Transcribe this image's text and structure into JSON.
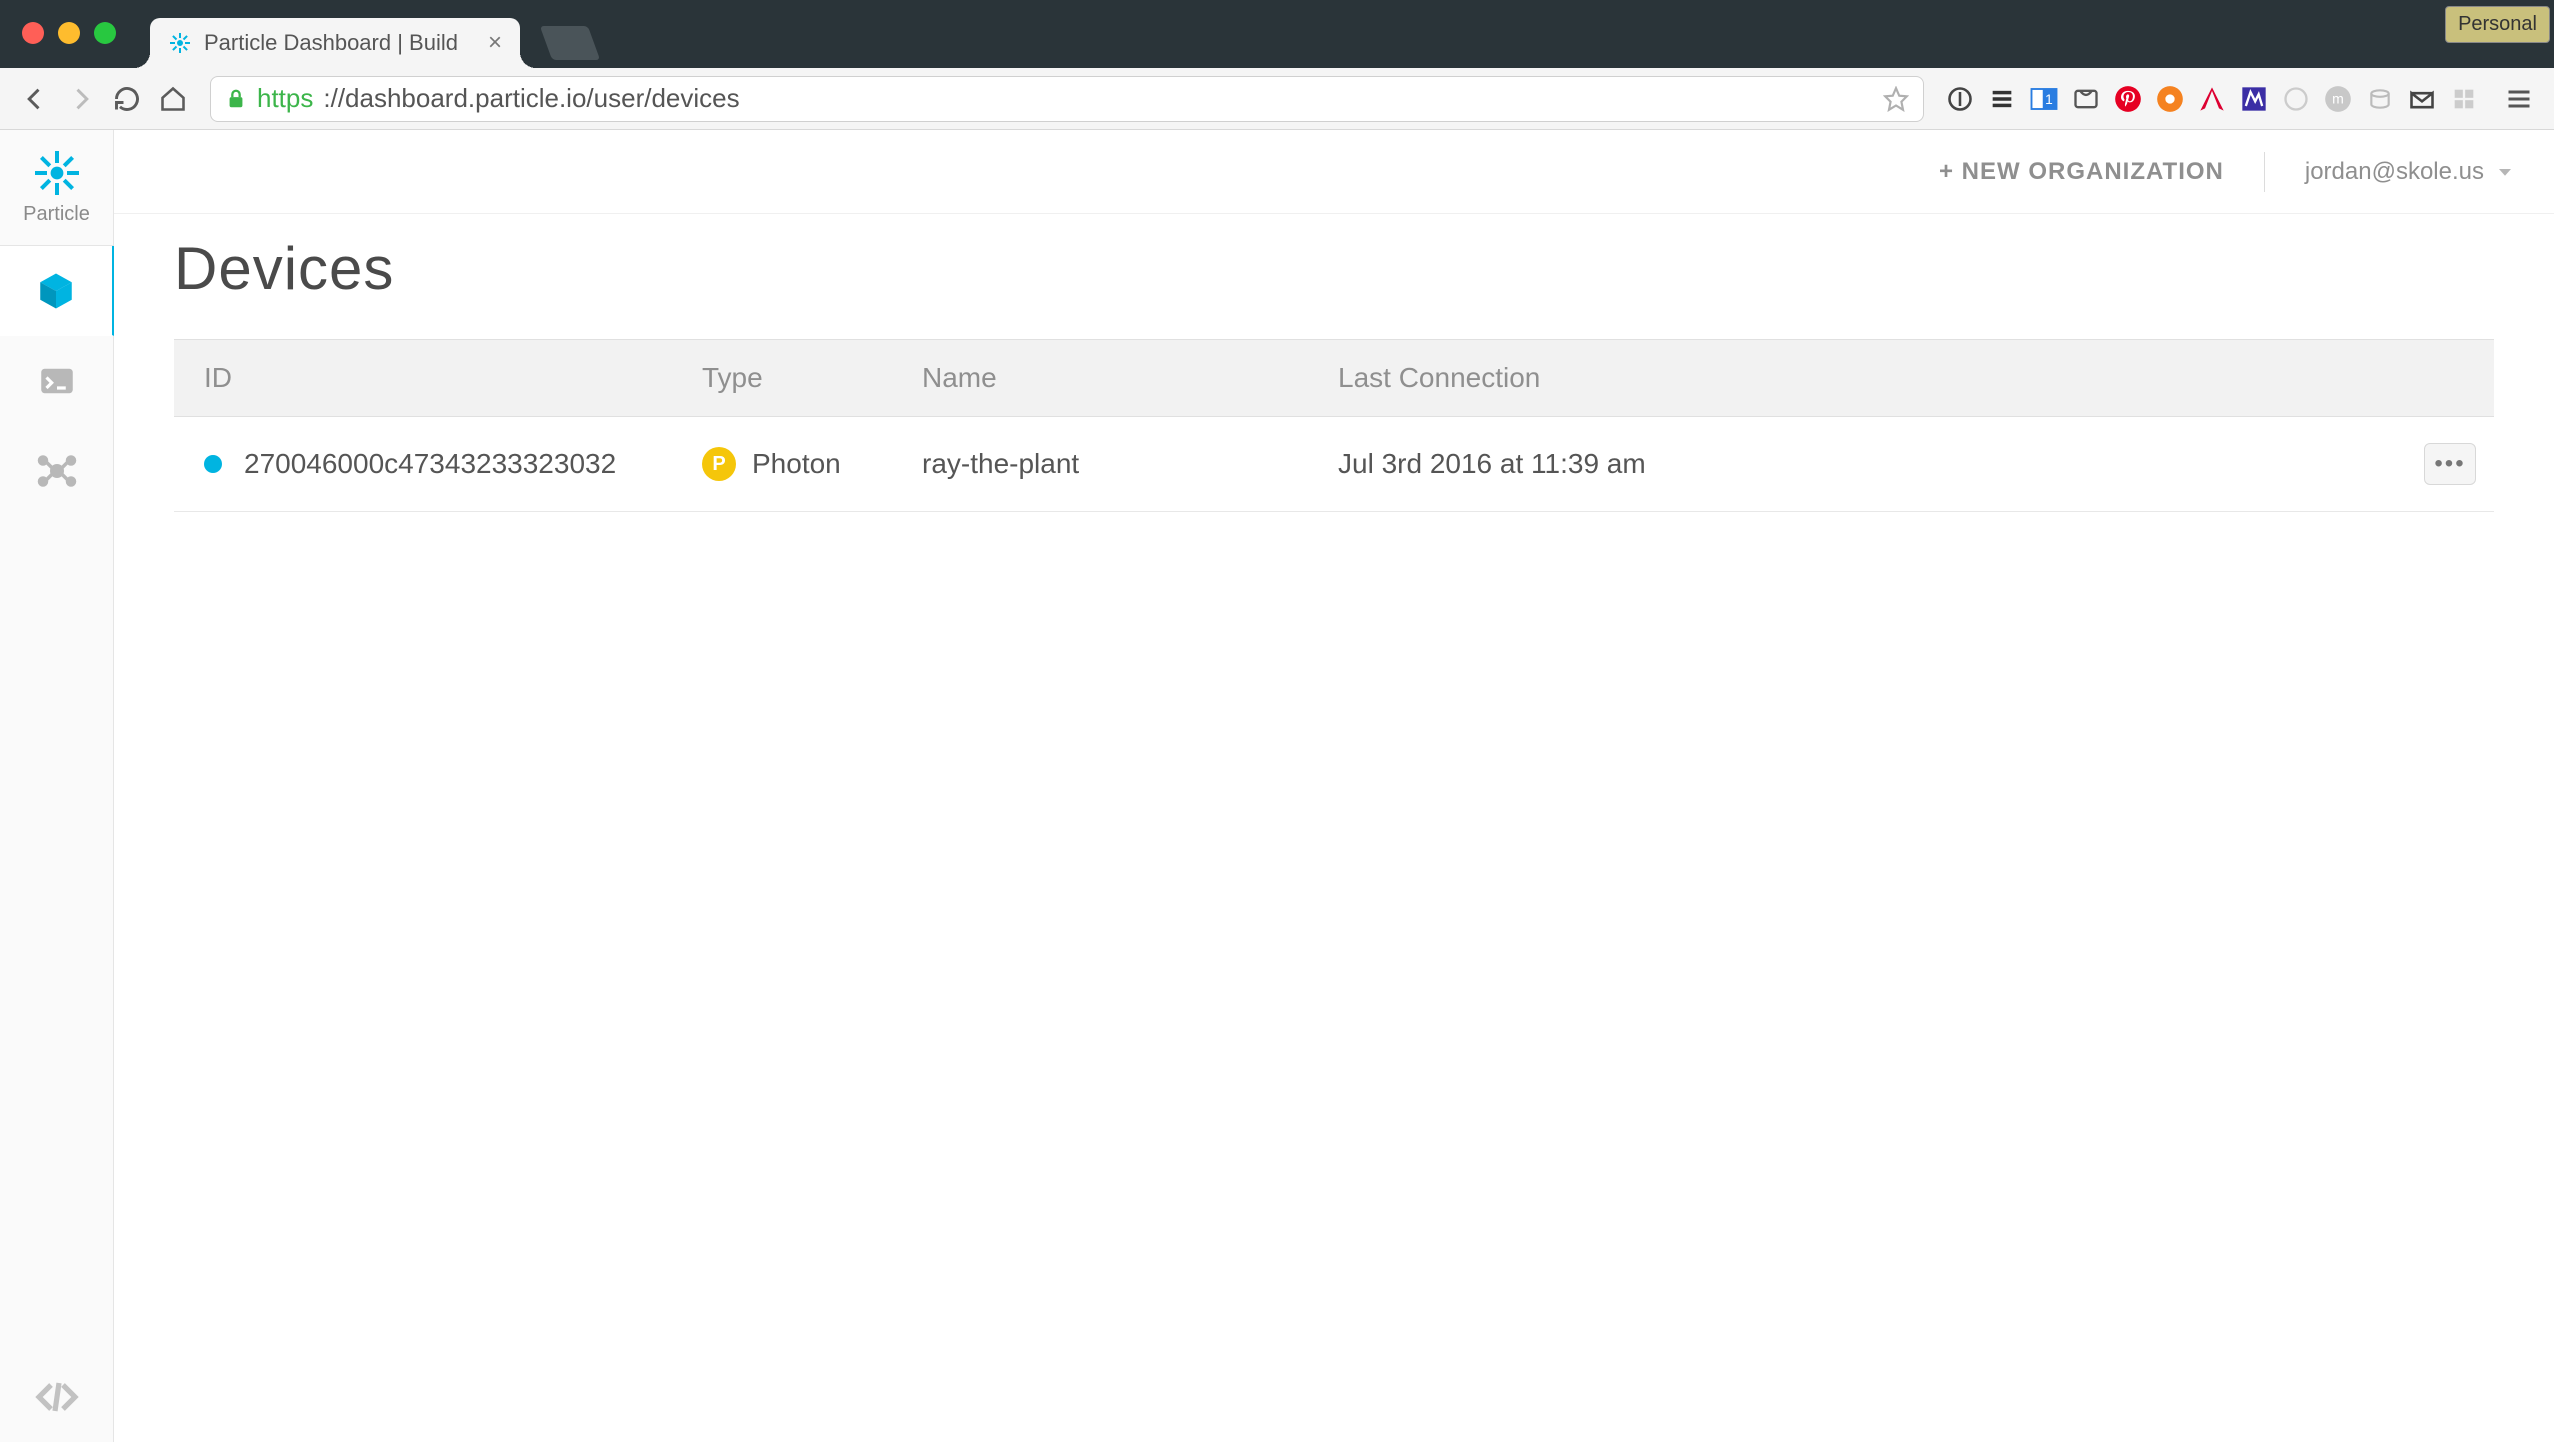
{
  "browser": {
    "tab_title": "Particle Dashboard | Build",
    "profile_chip": "Personal",
    "url_secure": "https",
    "url_rest": "://dashboard.particle.io/user/devices"
  },
  "sidebar": {
    "brand": "Particle"
  },
  "topbar": {
    "new_org": "+ NEW ORGANIZATION",
    "user_email": "jordan@skole.us"
  },
  "page": {
    "title": "Devices"
  },
  "table": {
    "headers": {
      "id": "ID",
      "type": "Type",
      "name": "Name",
      "last": "Last Connection"
    },
    "rows": [
      {
        "status_color": "#00b4e1",
        "id": "270046000c47343233323032",
        "type_label": "Photon",
        "type_badge": "P",
        "name": "ray-the-plant",
        "last": "Jul 3rd 2016 at 11:39 am"
      }
    ]
  },
  "colors": {
    "accent": "#00b4e1",
    "badge_yellow": "#f5c60a"
  }
}
